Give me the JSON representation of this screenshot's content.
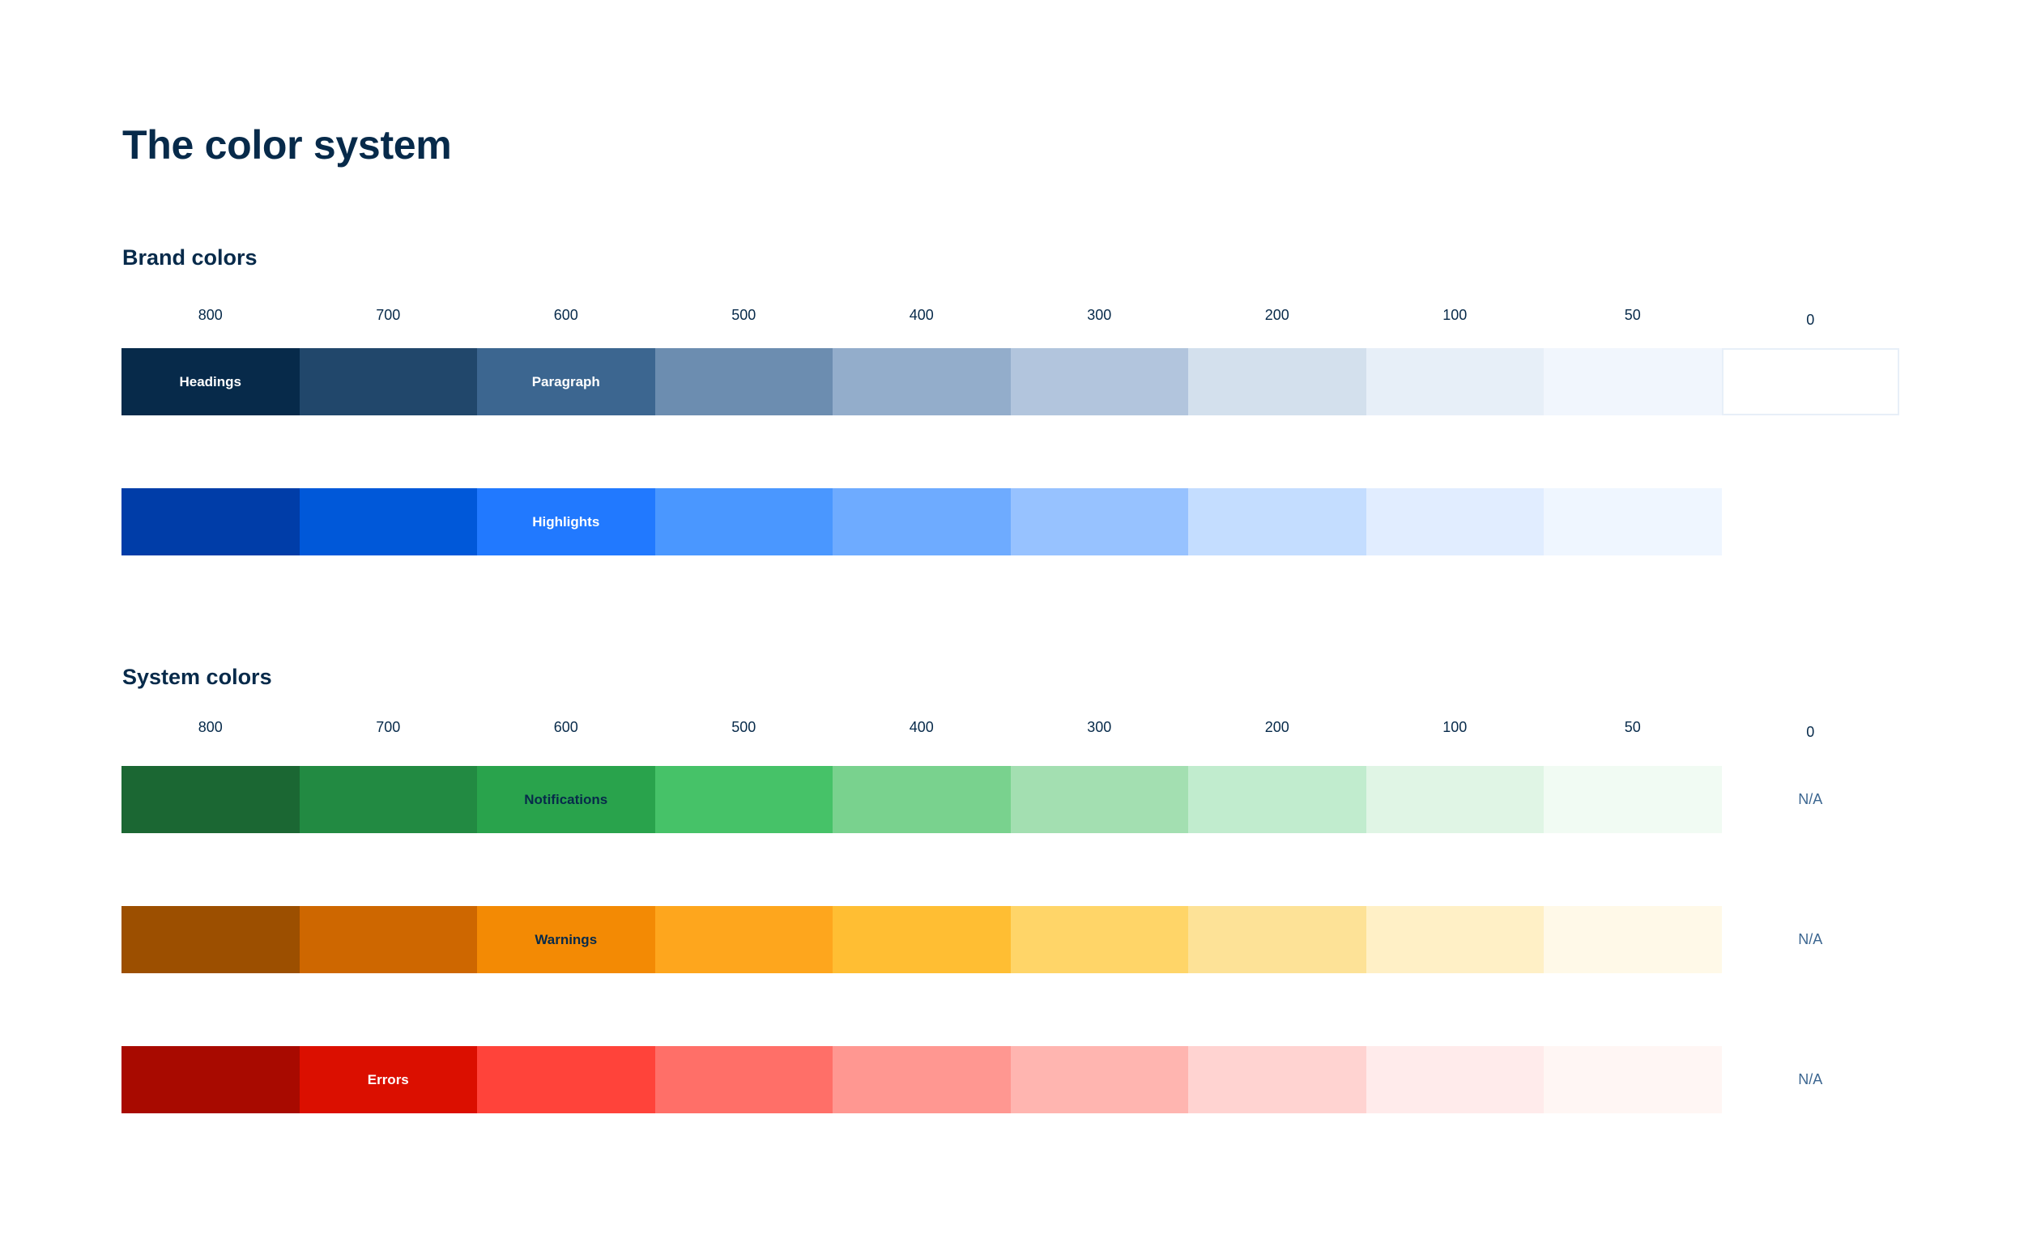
{
  "page": {
    "title": "The color system"
  },
  "brand": {
    "title": "Brand colors",
    "scale": [
      "800",
      "700",
      "600",
      "500",
      "400",
      "300",
      "200",
      "100",
      "50",
      "0"
    ],
    "rows": [
      {
        "name": "navy",
        "swatches": [
          {
            "shade": "800",
            "color": "#072A4A",
            "label": "Headings",
            "label_color": "#FFFFFF"
          },
          {
            "shade": "700",
            "color": "#21476B",
            "label": "",
            "label_color": "#FFFFFF"
          },
          {
            "shade": "600",
            "color": "#3C6690",
            "label": "Paragraph",
            "label_color": "#FFFFFF"
          },
          {
            "shade": "500",
            "color": "#6C8DB0",
            "label": "",
            "label_color": "#FFFFFF"
          },
          {
            "shade": "400",
            "color": "#93ADCB",
            "label": "",
            "label_color": "#FFFFFF"
          },
          {
            "shade": "300",
            "color": "#B2C5DD",
            "label": "",
            "label_color": "#072A4A"
          },
          {
            "shade": "200",
            "color": "#D3E0ED",
            "label": "",
            "label_color": "#072A4A"
          },
          {
            "shade": "100",
            "color": "#E7EFF8",
            "label": "",
            "label_color": "#072A4A"
          },
          {
            "shade": "50",
            "color": "#F1F6FD",
            "label": "",
            "label_color": "#072A4A"
          },
          {
            "shade": "0",
            "color": "#FFFFFF",
            "label": "",
            "label_color": "#072A4A",
            "bordered": true
          }
        ]
      },
      {
        "name": "blue",
        "swatches": [
          {
            "shade": "800",
            "color": "#003DA8",
            "label": "",
            "label_color": "#FFFFFF"
          },
          {
            "shade": "700",
            "color": "#0058D9",
            "label": "",
            "label_color": "#FFFFFF"
          },
          {
            "shade": "600",
            "color": "#2179FF",
            "label": "Highlights",
            "label_color": "#FFFFFF"
          },
          {
            "shade": "500",
            "color": "#4A97FF",
            "label": "",
            "label_color": "#FFFFFF"
          },
          {
            "shade": "400",
            "color": "#6EABFF",
            "label": "",
            "label_color": "#FFFFFF"
          },
          {
            "shade": "300",
            "color": "#97C2FF",
            "label": "",
            "label_color": "#072A4A"
          },
          {
            "shade": "200",
            "color": "#C4DDFF",
            "label": "",
            "label_color": "#072A4A"
          },
          {
            "shade": "100",
            "color": "#E1EDFF",
            "label": "",
            "label_color": "#072A4A"
          },
          {
            "shade": "50",
            "color": "#EFF6FF",
            "label": "",
            "label_color": "#072A4A"
          }
        ]
      }
    ]
  },
  "system": {
    "title": "System colors",
    "scale": [
      "800",
      "700",
      "600",
      "500",
      "400",
      "300",
      "200",
      "100",
      "50",
      "0"
    ],
    "rows": [
      {
        "name": "green",
        "zero_label": "N/A",
        "swatches": [
          {
            "shade": "800",
            "color": "#1B6733",
            "label": "",
            "label_color": "#072A4A"
          },
          {
            "shade": "700",
            "color": "#228A42",
            "label": "",
            "label_color": "#072A4A"
          },
          {
            "shade": "600",
            "color": "#29A34C",
            "label": "Notifications",
            "label_color": "#072A4A"
          },
          {
            "shade": "500",
            "color": "#46C268",
            "label": "",
            "label_color": "#072A4A"
          },
          {
            "shade": "400",
            "color": "#79D28E",
            "label": "",
            "label_color": "#072A4A"
          },
          {
            "shade": "300",
            "color": "#A3DFB1",
            "label": "",
            "label_color": "#072A4A"
          },
          {
            "shade": "200",
            "color": "#C1ECCE",
            "label": "",
            "label_color": "#072A4A"
          },
          {
            "shade": "100",
            "color": "#E0F5E5",
            "label": "",
            "label_color": "#072A4A"
          },
          {
            "shade": "50",
            "color": "#F1FBF3",
            "label": "",
            "label_color": "#072A4A"
          }
        ]
      },
      {
        "name": "orange",
        "zero_label": "N/A",
        "swatches": [
          {
            "shade": "800",
            "color": "#9C4F00",
            "label": "",
            "label_color": "#072A4A"
          },
          {
            "shade": "700",
            "color": "#CE6700",
            "label": "",
            "label_color": "#072A4A"
          },
          {
            "shade": "600",
            "color": "#F38A04",
            "label": "Warnings",
            "label_color": "#072A4A"
          },
          {
            "shade": "500",
            "color": "#FEA61D",
            "label": "",
            "label_color": "#072A4A"
          },
          {
            "shade": "400",
            "color": "#FFBE33",
            "label": "",
            "label_color": "#072A4A"
          },
          {
            "shade": "300",
            "color": "#FFD568",
            "label": "",
            "label_color": "#072A4A"
          },
          {
            "shade": "200",
            "color": "#FDE297",
            "label": "",
            "label_color": "#072A4A"
          },
          {
            "shade": "100",
            "color": "#FFF0C6",
            "label": "",
            "label_color": "#072A4A"
          },
          {
            "shade": "50",
            "color": "#FFF9E8",
            "label": "",
            "label_color": "#072A4A"
          }
        ]
      },
      {
        "name": "red",
        "zero_label": "N/A",
        "swatches": [
          {
            "shade": "800",
            "color": "#A80A00",
            "label": "",
            "label_color": "#FFFFFF"
          },
          {
            "shade": "700",
            "color": "#DB0F00",
            "label": "Errors",
            "label_color": "#FFFFFF"
          },
          {
            "shade": "600",
            "color": "#FF433A",
            "label": "",
            "label_color": "#FFFFFF"
          },
          {
            "shade": "500",
            "color": "#FF6F68",
            "label": "",
            "label_color": "#FFFFFF"
          },
          {
            "shade": "400",
            "color": "#FF9791",
            "label": "",
            "label_color": "#072A4A"
          },
          {
            "shade": "300",
            "color": "#FFB5B0",
            "label": "",
            "label_color": "#072A4A"
          },
          {
            "shade": "200",
            "color": "#FFD3D1",
            "label": "",
            "label_color": "#072A4A"
          },
          {
            "shade": "100",
            "color": "#FFEBEB",
            "label": "",
            "label_color": "#072A4A"
          },
          {
            "shade": "50",
            "color": "#FFF6F4",
            "label": "",
            "label_color": "#072A4A"
          }
        ]
      }
    ]
  }
}
